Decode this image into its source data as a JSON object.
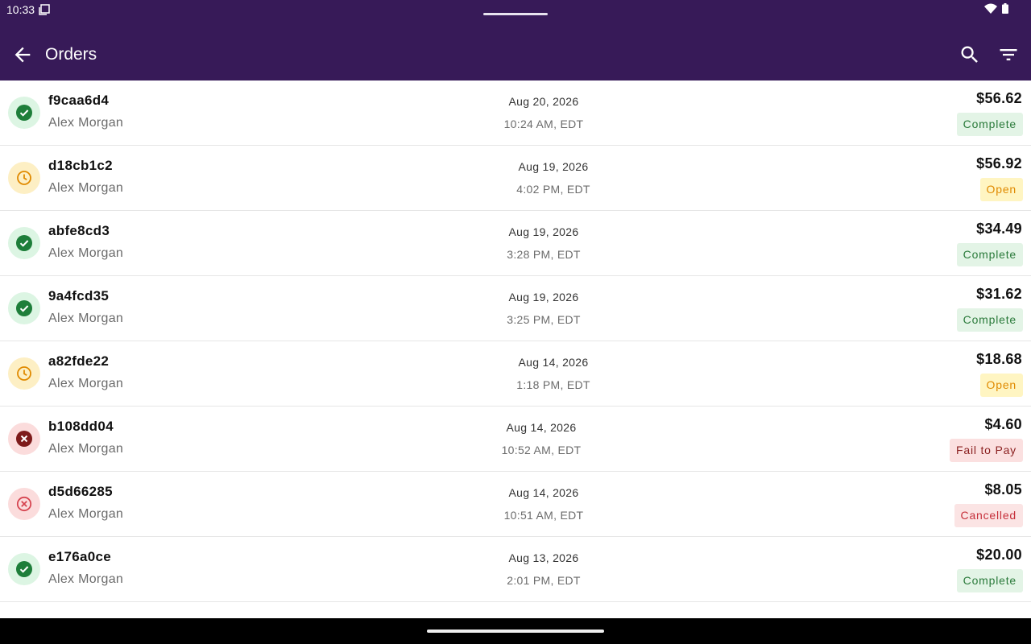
{
  "status_bar": {
    "time": "10:33"
  },
  "app_bar": {
    "title": "Orders",
    "back_icon": "arrow-back-icon",
    "search_icon": "search-icon",
    "filter_icon": "filter-icon"
  },
  "colors": {
    "app_bar": "#371a58",
    "complete": "#1e7e3a",
    "open": "#e08a00",
    "failed": "#7d1a1a",
    "cancelled": "#d64550"
  },
  "orders": [
    {
      "id": "f9caa6d4",
      "customer": "Alex Morgan",
      "date": "Aug 20, 2026",
      "time": "10:24 AM, EDT",
      "amount": "$56.62",
      "status": "Complete",
      "status_icon": "check-circle-icon"
    },
    {
      "id": "d18cb1c2",
      "customer": "Alex Morgan",
      "date": "Aug 19, 2026",
      "time": "4:02 PM, EDT",
      "amount": "$56.92",
      "status": "Open",
      "status_icon": "clock-icon"
    },
    {
      "id": "abfe8cd3",
      "customer": "Alex Morgan",
      "date": "Aug 19, 2026",
      "time": "3:28 PM, EDT",
      "amount": "$34.49",
      "status": "Complete",
      "status_icon": "check-circle-icon"
    },
    {
      "id": "9a4fcd35",
      "customer": "Alex Morgan",
      "date": "Aug 19, 2026",
      "time": "3:25 PM, EDT",
      "amount": "$31.62",
      "status": "Complete",
      "status_icon": "check-circle-icon"
    },
    {
      "id": "a82fde22",
      "customer": "Alex Morgan",
      "date": "Aug 14, 2026",
      "time": "1:18 PM, EDT",
      "amount": "$18.68",
      "status": "Open",
      "status_icon": "clock-icon"
    },
    {
      "id": "b108dd04",
      "customer": "Alex Morgan",
      "date": "Aug 14, 2026",
      "time": "10:52 AM, EDT",
      "amount": "$4.60",
      "status": "Fail to Pay",
      "status_icon": "x-circle-icon"
    },
    {
      "id": "d5d66285",
      "customer": "Alex Morgan",
      "date": "Aug 14, 2026",
      "time": "10:51 AM, EDT",
      "amount": "$8.05",
      "status": "Cancelled",
      "status_icon": "x-circle-outline-icon"
    },
    {
      "id": "e176a0ce",
      "customer": "Alex Morgan",
      "date": "Aug 13, 2026",
      "time": "2:01 PM, EDT",
      "amount": "$20.00",
      "status": "Complete",
      "status_icon": "check-circle-icon"
    }
  ]
}
